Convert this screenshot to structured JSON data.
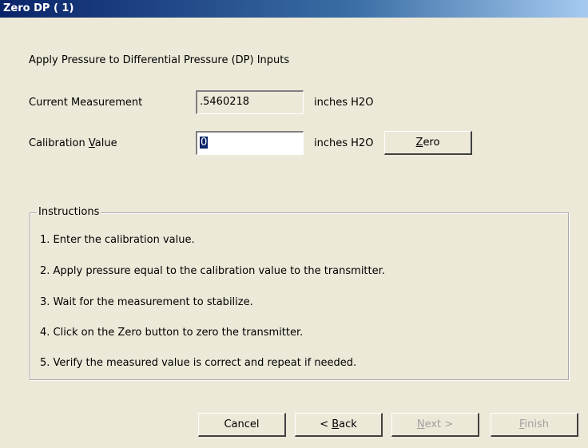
{
  "window": {
    "title": "Zero DP ( 1)"
  },
  "header": {
    "prompt": "Apply Pressure to Differential Pressure (DP) Inputs"
  },
  "form": {
    "current_label": "Current Measurement",
    "current_value": ".5460218",
    "current_unit": "inches H2O",
    "calibration_label_pre": "Calibration ",
    "calibration_label_ul": "V",
    "calibration_label_post": "alue",
    "calibration_value": "0",
    "calibration_unit": "inches H2O",
    "zero_button": {
      "ul": "Z",
      "rest": "ero"
    }
  },
  "instructions": {
    "legend": "Instructions",
    "steps": [
      "1. Enter the calibration value.",
      "2. Apply pressure equal to the calibration value to the transmitter.",
      "3. Wait for the measurement to stabilize.",
      "4. Click on the Zero button to zero the transmitter.",
      "5. Verify the measured value is correct and repeat if needed."
    ]
  },
  "footer": {
    "cancel": "Cancel",
    "back": {
      "pre": "< ",
      "ul": "B",
      "rest": "ack"
    },
    "next": {
      "ul": "N",
      "rest": "ext >"
    },
    "finish": {
      "ul": "F",
      "rest": "inish"
    }
  }
}
